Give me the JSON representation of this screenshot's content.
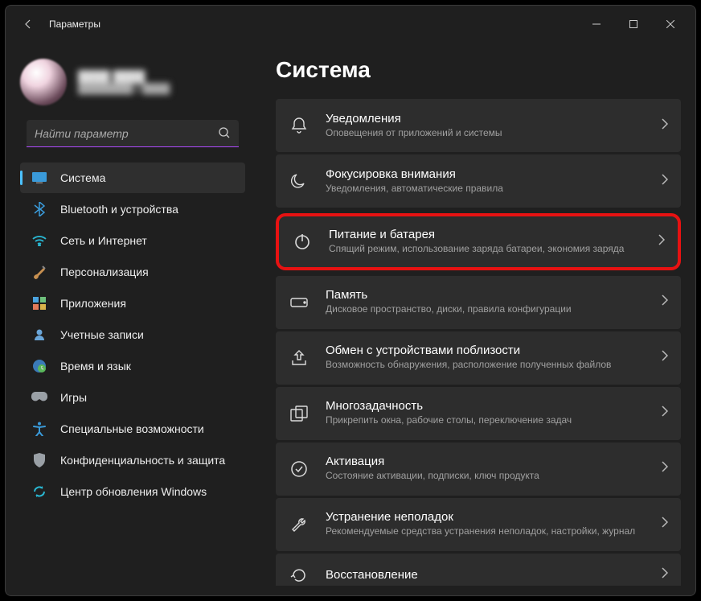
{
  "window": {
    "title": "Параметры"
  },
  "profile": {
    "name": "████ ████",
    "email": "████████@████"
  },
  "search": {
    "placeholder": "Найти параметр"
  },
  "nav": {
    "items": [
      {
        "label": "Система"
      },
      {
        "label": "Bluetooth и устройства"
      },
      {
        "label": "Сеть и Интернет"
      },
      {
        "label": "Персонализация"
      },
      {
        "label": "Приложения"
      },
      {
        "label": "Учетные записи"
      },
      {
        "label": "Время и язык"
      },
      {
        "label": "Игры"
      },
      {
        "label": "Специальные возможности"
      },
      {
        "label": "Конфиденциальность и защита"
      },
      {
        "label": "Центр обновления Windows"
      }
    ]
  },
  "main": {
    "heading": "Система",
    "cards": [
      {
        "title": "Уведомления",
        "sub": "Оповещения от приложений и системы"
      },
      {
        "title": "Фокусировка внимания",
        "sub": "Уведомления, автоматические правила"
      },
      {
        "title": "Питание и батарея",
        "sub": "Спящий режим, использование заряда батареи, экономия заряда"
      },
      {
        "title": "Память",
        "sub": "Дисковое пространство, диски, правила конфигурации"
      },
      {
        "title": "Обмен с устройствами поблизости",
        "sub": "Возможность обнаружения, расположение полученных файлов"
      },
      {
        "title": "Многозадачность",
        "sub": "Прикрепить окна, рабочие столы, переключение задач"
      },
      {
        "title": "Активация",
        "sub": "Состояние активации, подписки, ключ продукта"
      },
      {
        "title": "Устранение неполадок",
        "sub": "Рекомендуемые средства устранения неполадок, настройки, журнал"
      },
      {
        "title": "Восстановление",
        "sub": ""
      }
    ]
  }
}
